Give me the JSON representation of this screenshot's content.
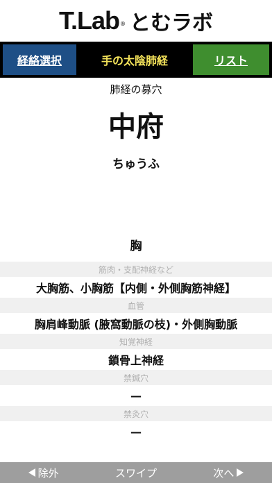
{
  "brand": {
    "logo": "T.Lab",
    "registered": "®",
    "kana": "とむラボ"
  },
  "nav": {
    "left_button": "経絡選択",
    "title": "手の太陰肺経",
    "right_button": "リスト"
  },
  "point": {
    "category": "肺経の募穴",
    "name": "中府",
    "reading": "ちゅうふ",
    "region": "胸"
  },
  "details": [
    {
      "label": "筋肉・支配神経など",
      "value": "大胸筋、小胸筋【内側・外側胸筋神経】"
    },
    {
      "label": "血管",
      "value": "胸肩峰動脈 (腋窩動脈の枝)・外側胸動脈"
    },
    {
      "label": "知覚神経",
      "value": "鎖骨上神経"
    },
    {
      "label": "禁鍼穴",
      "value": "—"
    },
    {
      "label": "禁灸穴",
      "value": "—"
    }
  ],
  "footer": {
    "prev_icon": "triangle-left-icon",
    "prev_label": "除外",
    "middle_label": "スワイプ",
    "next_label": "次へ",
    "next_icon": "triangle-right-icon"
  },
  "colors": {
    "nav_background": "#000000",
    "left_button": "#1e4f86",
    "right_button": "#3f8e2f",
    "title_text": "#f3e25a",
    "footer_background": "#9e9e9e"
  }
}
